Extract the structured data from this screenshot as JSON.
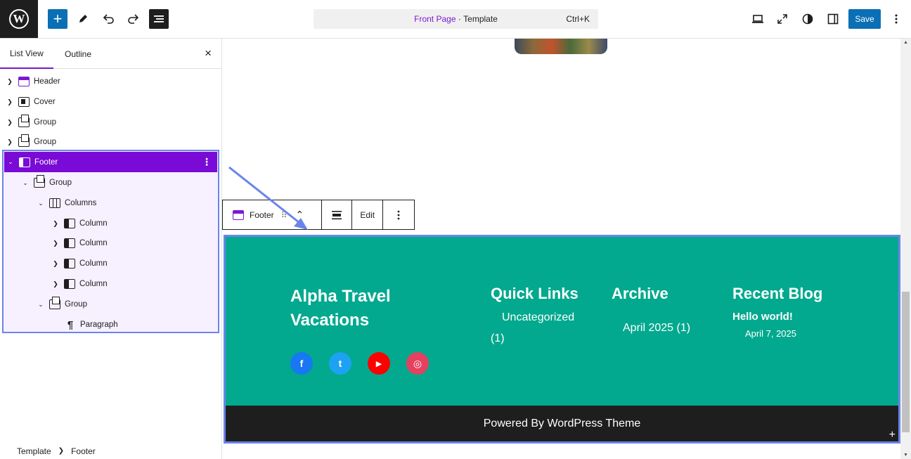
{
  "topbar": {
    "add_label": "+",
    "command": {
      "page": "Front Page",
      "sep": " · ",
      "type": "Template",
      "shortcut": "Ctrl+K"
    },
    "save_label": "Save"
  },
  "sidebar": {
    "tabs": [
      "List View",
      "Outline"
    ],
    "close_icon": "×",
    "tree": [
      {
        "label": "Header",
        "icon": "header-icon"
      },
      {
        "label": "Cover",
        "icon": "cover-icon"
      },
      {
        "label": "Group",
        "icon": "group-icon"
      },
      {
        "label": "Group",
        "icon": "group-icon"
      },
      {
        "label": "Footer",
        "icon": "footer-icon",
        "selected": true
      },
      {
        "label": "Group",
        "icon": "group-icon"
      },
      {
        "label": "Columns",
        "icon": "columns-icon"
      },
      {
        "label": "Column",
        "icon": "column-icon"
      },
      {
        "label": "Column",
        "icon": "column-icon"
      },
      {
        "label": "Column",
        "icon": "column-icon"
      },
      {
        "label": "Column",
        "icon": "column-icon"
      },
      {
        "label": "Group",
        "icon": "group-icon"
      },
      {
        "label": "Paragraph",
        "icon": "paragraph-icon"
      }
    ],
    "breadcrumb": [
      "Template",
      "Footer"
    ]
  },
  "block_toolbar": {
    "label": "Footer",
    "edit": "Edit"
  },
  "footer": {
    "site_title": "Alpha Travel Vacations",
    "quick_links": {
      "heading": "Quick Links",
      "item": "Uncategorized",
      "count": "(1)"
    },
    "archive": {
      "heading": "Archive",
      "item": "April 2025 (1)"
    },
    "recent_blog": {
      "heading": "Recent Blog",
      "post": "Hello world!",
      "date": "April 7, 2025"
    },
    "social": [
      {
        "name": "facebook",
        "glyph": "f",
        "color": "#1877f2"
      },
      {
        "name": "twitter",
        "glyph": "t",
        "color": "#1da1f2"
      },
      {
        "name": "youtube",
        "glyph": "▶",
        "color": "#ff0000"
      },
      {
        "name": "instagram",
        "glyph": "◎",
        "color": "#e4405f"
      }
    ],
    "credit": "Powered By WordPress Theme"
  },
  "colors": {
    "accent": "#7b19d0",
    "primary": "#0a6fb5",
    "teal": "#02a98e",
    "highlight": "#6a84ea"
  }
}
